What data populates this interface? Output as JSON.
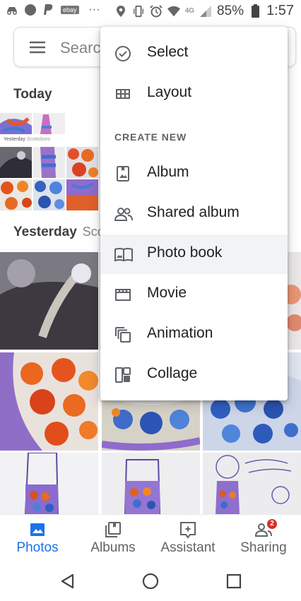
{
  "status_bar": {
    "ebay_badge": "ebay",
    "dots": "···",
    "network": "4G",
    "battery": "85%",
    "time": "1:57"
  },
  "search": {
    "placeholder": "Search"
  },
  "sections": {
    "today": "Today",
    "yesterday": "Yesterday",
    "yesterday_location": "Scottsboro",
    "inline_yesterday": "Yesterday",
    "inline_location": "Scottsboro"
  },
  "menu": {
    "items_top": [
      {
        "label": "Select",
        "icon": "check-circle-icon"
      },
      {
        "label": "Layout",
        "icon": "grid-icon"
      }
    ],
    "section_label": "CREATE NEW",
    "items_create": [
      {
        "label": "Album",
        "icon": "album-icon"
      },
      {
        "label": "Shared album",
        "icon": "shared-album-icon"
      },
      {
        "label": "Photo book",
        "icon": "photo-book-icon",
        "highlighted": true
      },
      {
        "label": "Movie",
        "icon": "movie-icon"
      },
      {
        "label": "Animation",
        "icon": "animation-icon"
      },
      {
        "label": "Collage",
        "icon": "collage-icon"
      }
    ]
  },
  "bottom_nav": {
    "tabs": [
      {
        "label": "Photos",
        "icon": "photos-icon",
        "active": true
      },
      {
        "label": "Albums",
        "icon": "albums-icon"
      },
      {
        "label": "Assistant",
        "icon": "assistant-icon"
      },
      {
        "label": "Sharing",
        "icon": "sharing-icon",
        "badge": "2"
      }
    ]
  },
  "colors": {
    "accent": "#1a73e8",
    "badge": "#d93025",
    "menu_highlight": "#f1f3f4"
  }
}
